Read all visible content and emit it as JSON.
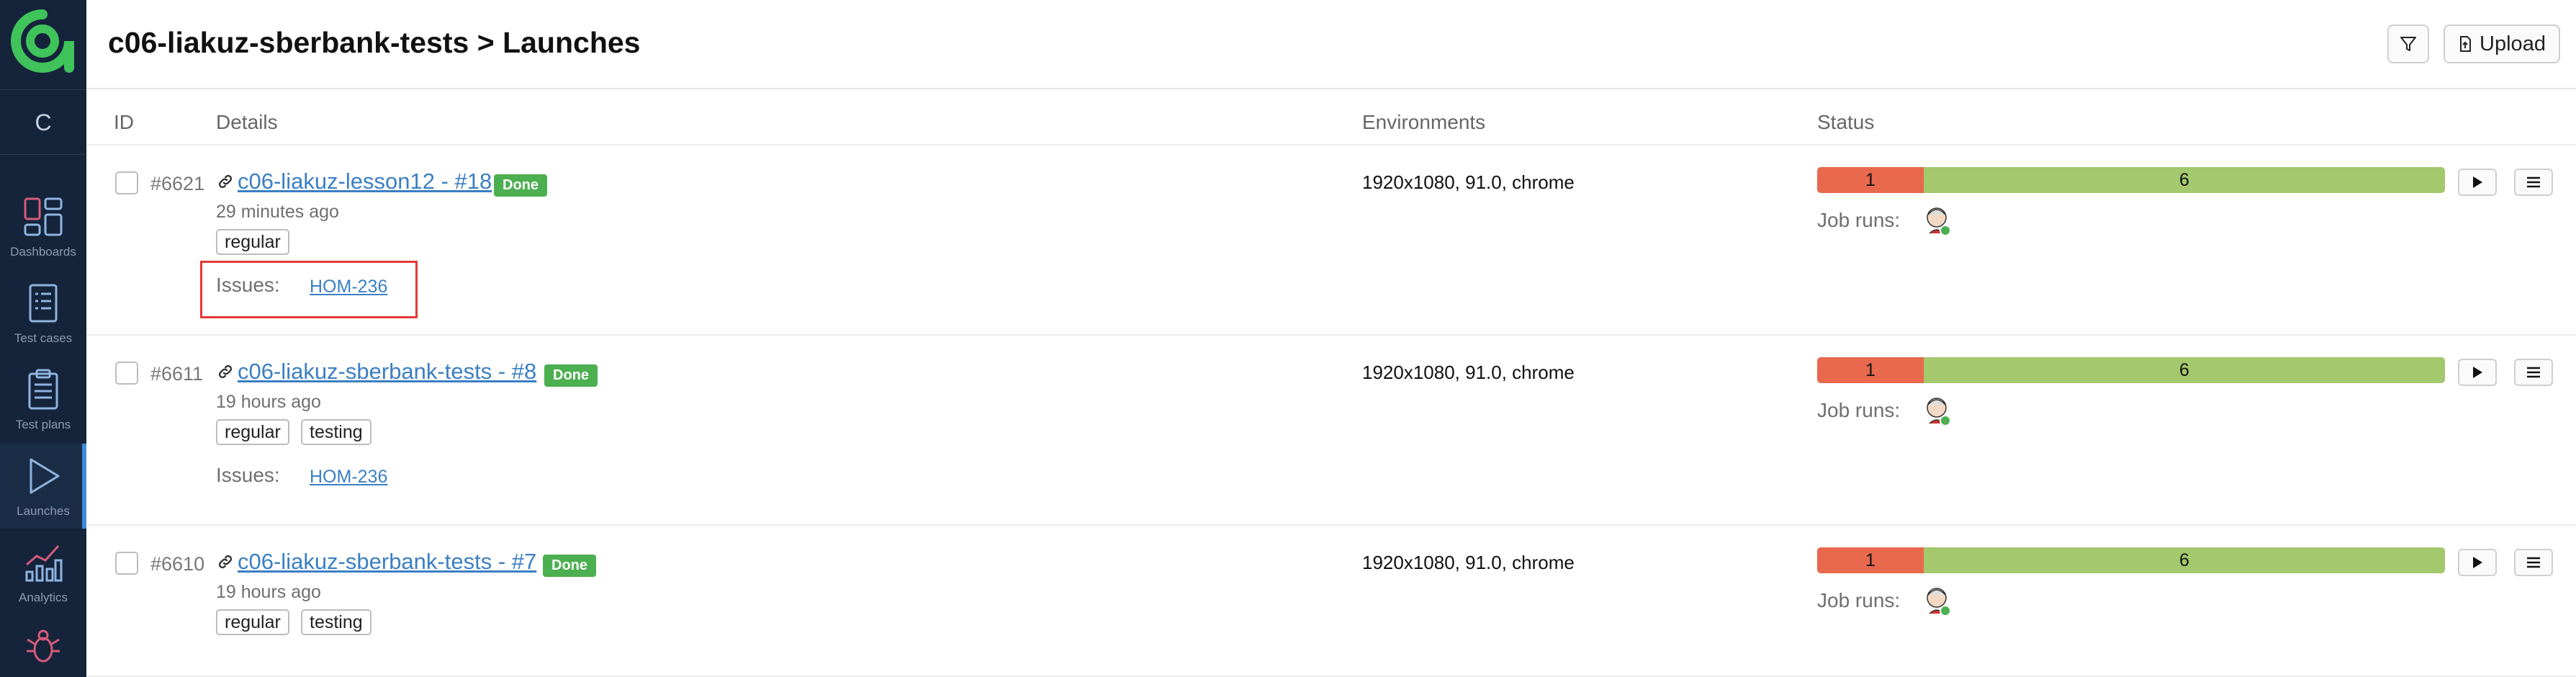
{
  "breadcrumb": {
    "project": "c06-liakuz-sberbank-tests",
    "separator": ">",
    "page": "Launches"
  },
  "header": {
    "upload_label": "Upload"
  },
  "sidebar": {
    "project_initial": "C",
    "items": [
      {
        "label": "Dashboards",
        "icon": "dashboards-icon"
      },
      {
        "label": "Test cases",
        "icon": "test-cases-icon"
      },
      {
        "label": "Test plans",
        "icon": "test-plans-icon"
      },
      {
        "label": "Launches",
        "icon": "launches-icon",
        "active": true
      },
      {
        "label": "Analytics",
        "icon": "analytics-icon"
      },
      {
        "label": "",
        "icon": "defects-bug-icon"
      }
    ]
  },
  "table": {
    "columns": {
      "id": "ID",
      "details": "Details",
      "environments": "Environments",
      "status": "Status"
    },
    "rows": [
      {
        "id": "#6621",
        "name": "c06-liakuz-lesson12 - #18",
        "status": "Done",
        "time": "29 minutes ago",
        "tags": [
          "regular"
        ],
        "issues_label": "Issues:",
        "issue": "HOM-236",
        "env": "1920x1080, 91.0, chrome",
        "failed": "1",
        "passed": "6",
        "job_runs_label": "Job runs:"
      },
      {
        "id": "#6611",
        "name": "c06-liakuz-sberbank-tests - #8",
        "status": "Done",
        "time": "19 hours ago",
        "tags": [
          "regular",
          "testing"
        ],
        "issues_label": "Issues:",
        "issue": "HOM-236",
        "env": "1920x1080, 91.0, chrome",
        "failed": "1",
        "passed": "6",
        "job_runs_label": "Job runs:"
      },
      {
        "id": "#6610",
        "name": "c06-liakuz-sberbank-tests - #7",
        "status": "Done",
        "time": "19 hours ago",
        "tags": [
          "regular",
          "testing"
        ],
        "env": "1920x1080, 91.0, chrome",
        "failed": "1",
        "passed": "6",
        "job_runs_label": "Job runs:"
      }
    ]
  },
  "colors": {
    "sidebar_bg": "#15243b",
    "accent_green": "#4caf50",
    "failed": "#e8694d",
    "passed": "#a3c86d",
    "link": "#3b7fc4",
    "highlight": "#e53935"
  }
}
